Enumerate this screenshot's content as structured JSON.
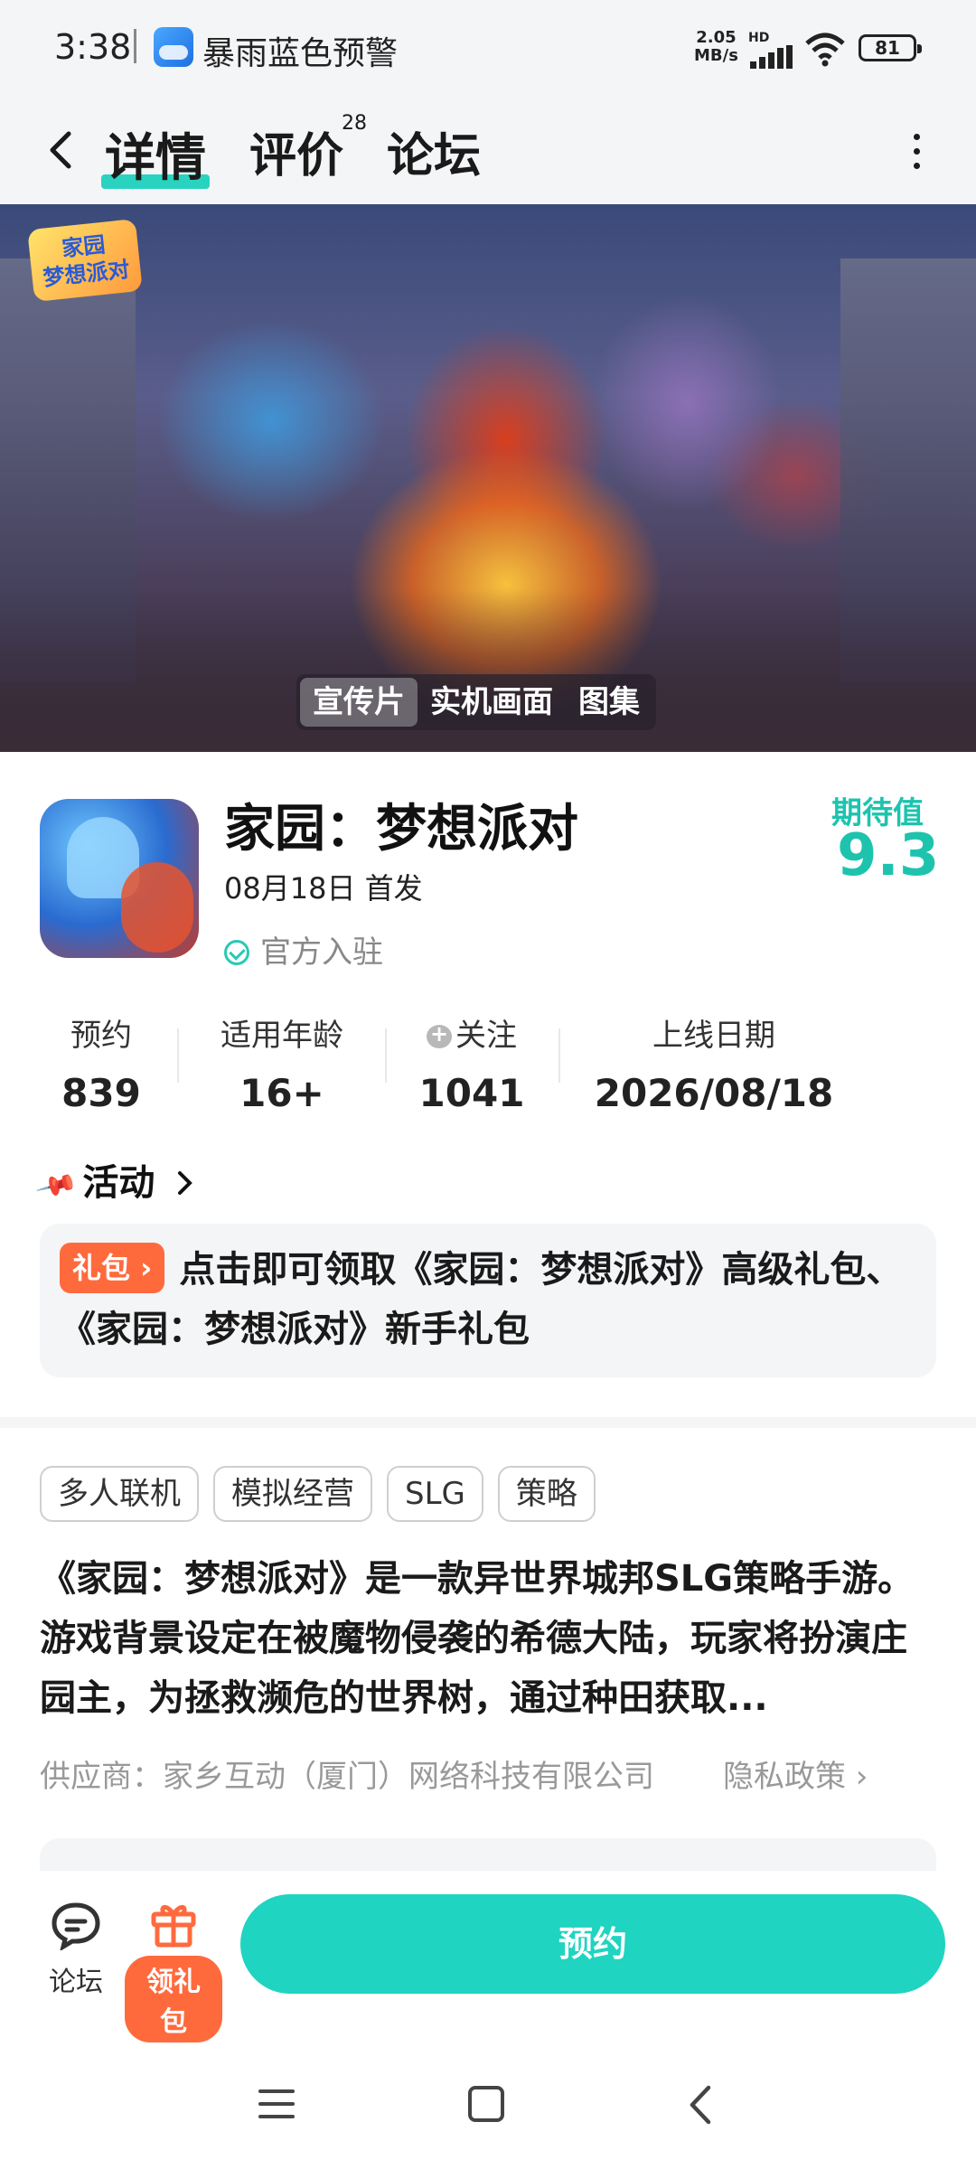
{
  "status_bar": {
    "time": "3:38",
    "notification": "暴雨蓝色预警",
    "net_speed_value": "2.05",
    "net_speed_unit": "MB/s",
    "hd": "HD",
    "battery": "81"
  },
  "nav": {
    "tabs": [
      {
        "label": "详情",
        "active": true
      },
      {
        "label": "评价",
        "badge": "28"
      },
      {
        "label": "论坛"
      }
    ]
  },
  "banner": {
    "logo_text_line1": "家园",
    "logo_text_line2": "梦想派对",
    "media_tabs": [
      "宣传片",
      "实机画面",
      "图集"
    ],
    "active_media_tab": "宣传片"
  },
  "app": {
    "title": "家园：梦想派对",
    "release": "08月18日 首发",
    "official": "官方入驻",
    "expect_label": "期待值",
    "expect_score": "9.3"
  },
  "stats": [
    {
      "label": "预约",
      "value": "839"
    },
    {
      "label": "适用年龄",
      "value": "16+"
    },
    {
      "label": "关注",
      "value": "1041"
    },
    {
      "label": "上线日期",
      "value": "2026/08/18"
    }
  ],
  "activity": {
    "title": "活动",
    "badge": "礼包",
    "text": "点击即可领取《家园：梦想派对》高级礼包、《家园：梦想派对》新手礼包"
  },
  "tags": [
    "多人联机",
    "模拟经营",
    "SLG",
    "策略"
  ],
  "description": "《家园：梦想派对》是一款异世界城邦SLG策略手游。游戏背景设定在被魔物侵袭的希德大陆，玩家将扮演庄园主，为拯救濒危的世界树，通过种田获取...",
  "supplier": "供应商：家乡互动（厦门）网络科技有限公司",
  "privacy": "隐私政策",
  "bottom_bar": {
    "forum_label": "论坛",
    "gift_label": "领礼包",
    "reserve_label": "预约"
  },
  "colors": {
    "accent": "#1fd4c0",
    "gift": "#ff6a3d",
    "score": "#1ec3ae"
  }
}
